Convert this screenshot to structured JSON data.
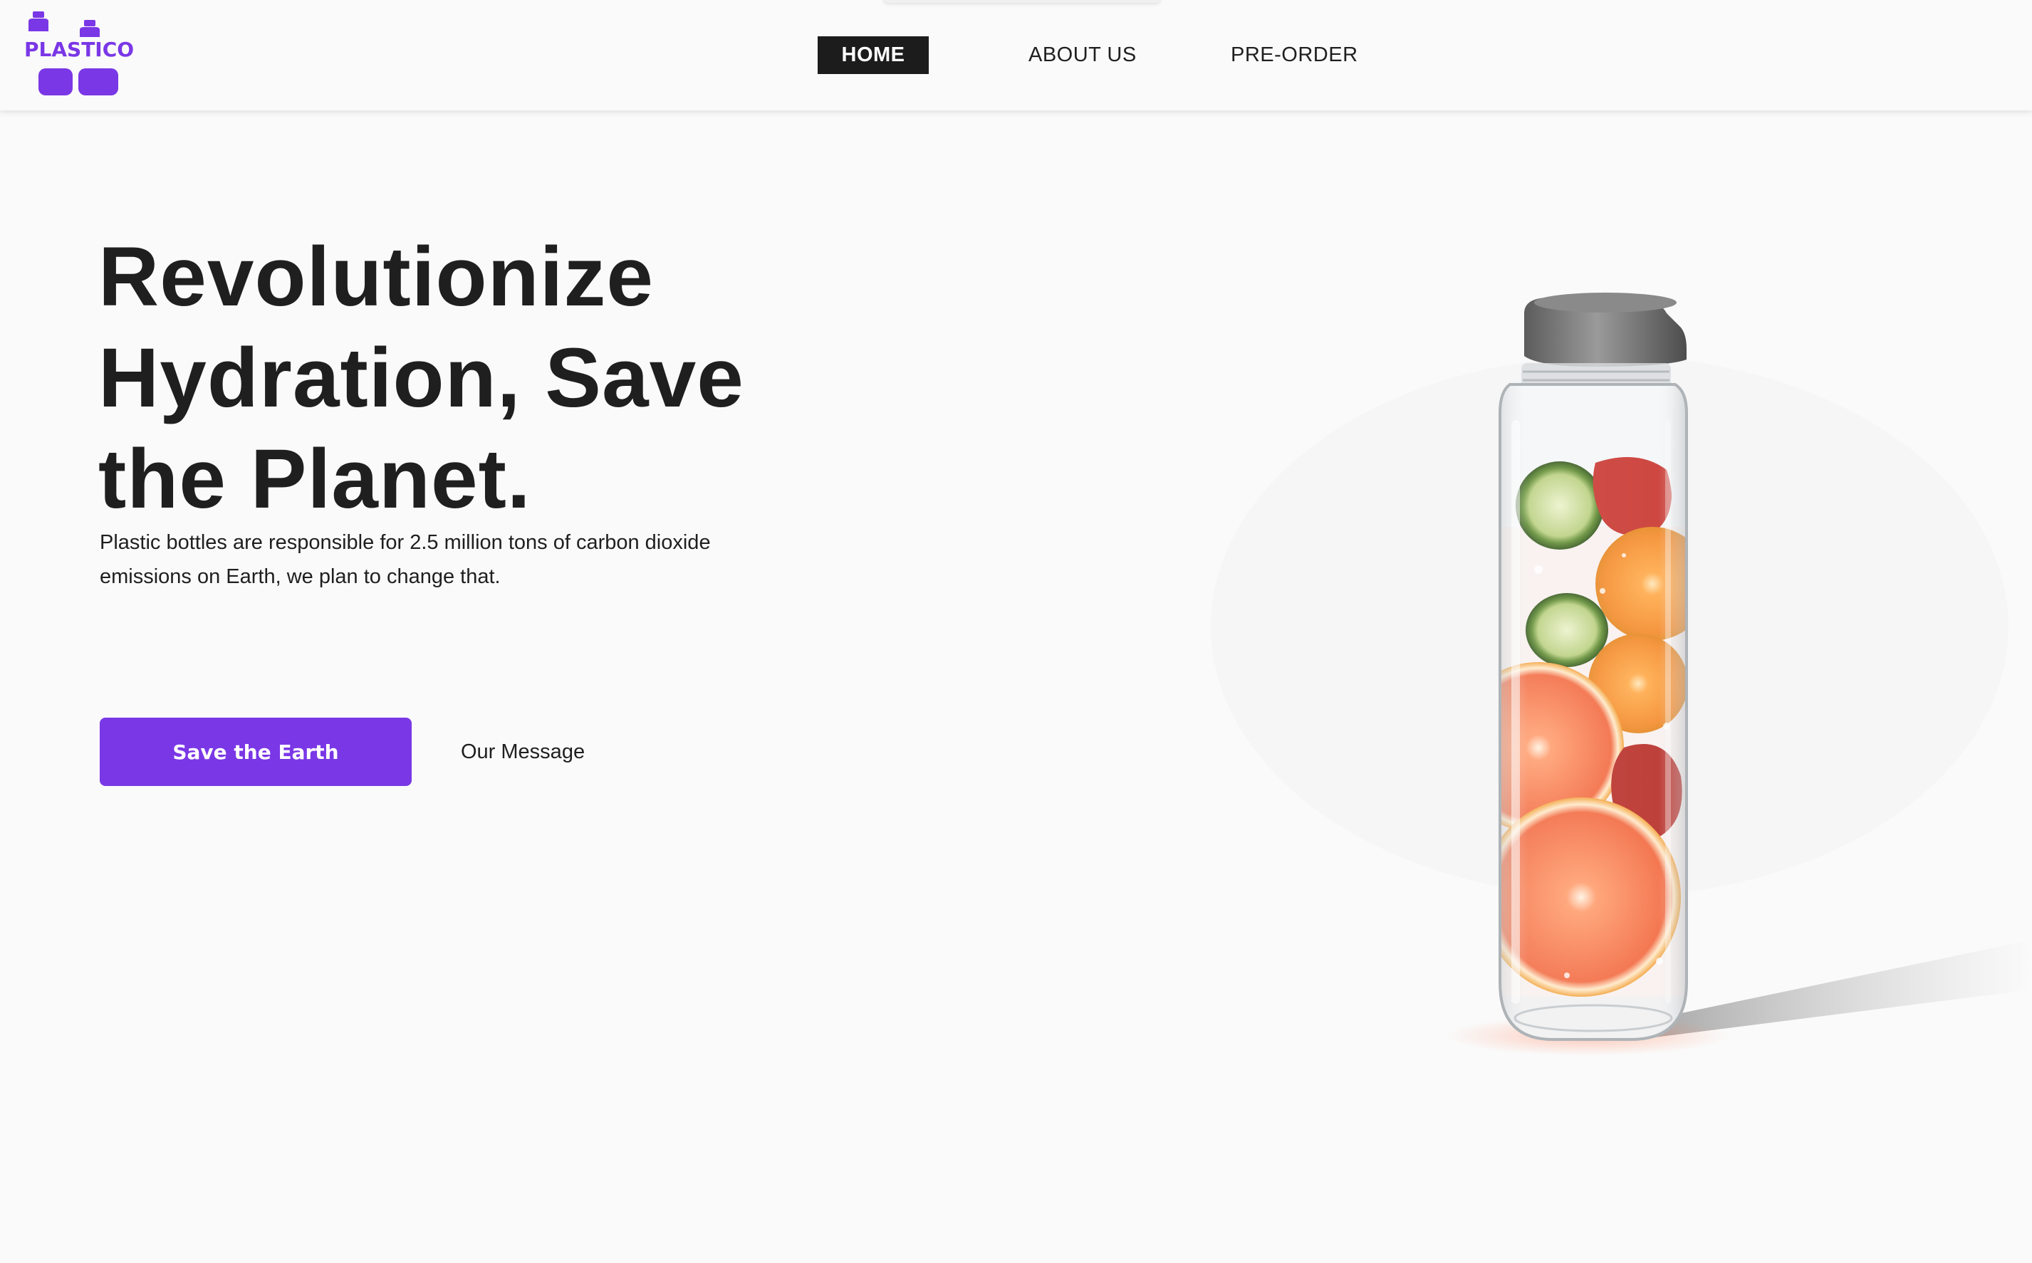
{
  "brand": {
    "name": "PLASTICO",
    "accent_color": "#7a37e6"
  },
  "nav": {
    "items": [
      {
        "label": "HOME",
        "active": true
      },
      {
        "label": "ABOUT US",
        "active": false
      },
      {
        "label": "PRE-ORDER",
        "active": false
      }
    ]
  },
  "hero": {
    "title_line1": "Revolutionize",
    "title_line2": "Hydration, Save",
    "title_line3": "the Planet.",
    "subtitle_line1": "Plastic bottles are responsible for 2.5 million tons of carbon dioxide",
    "subtitle_line2": "emissions on Earth, we plan to change that.",
    "primary_cta": "Save the Earth",
    "secondary_cta": "Our Message"
  },
  "product_image": {
    "icon": "fruit-infused-water-bottle"
  }
}
